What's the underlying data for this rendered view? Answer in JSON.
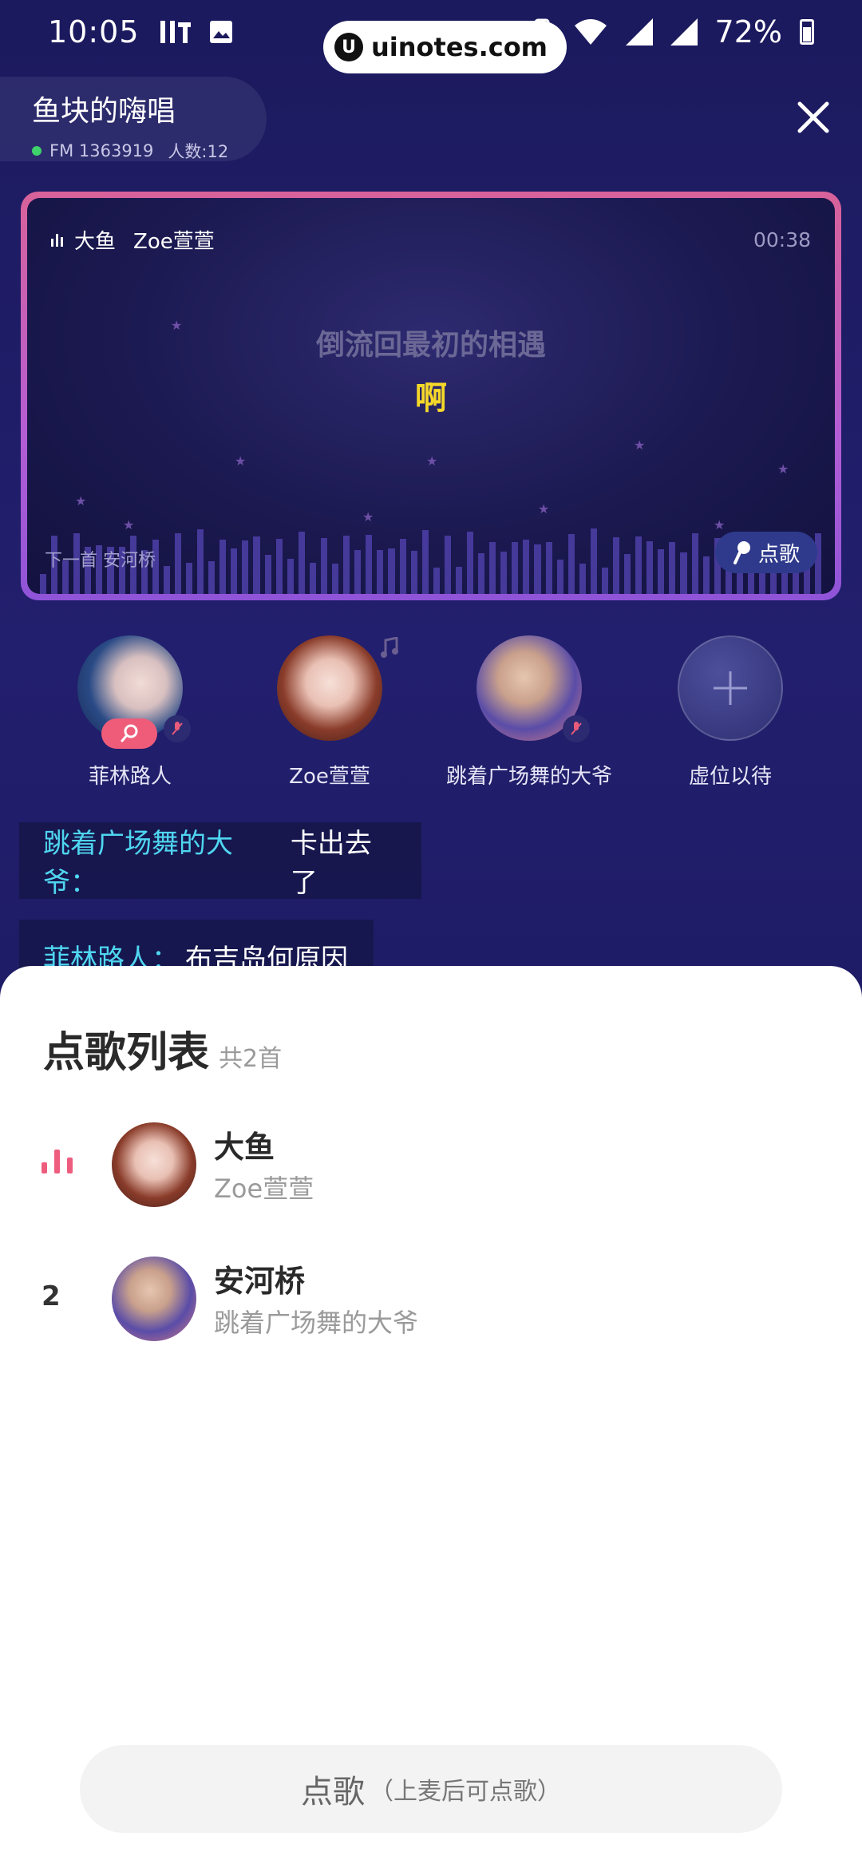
{
  "status_bar": {
    "time": "10:05",
    "battery": "72%",
    "watermark": "uinotes.com",
    "watermark_logo": "U"
  },
  "room": {
    "title": "鱼块的嗨唱",
    "fm": "FM 1363919",
    "count": "人数:12"
  },
  "stage": {
    "song": "大鱼",
    "singer": "Zoe萱萱",
    "time": "00:38",
    "lyric_prev": "倒流回最初的相遇",
    "lyric_current": "啊",
    "next_up": "下一首 安河桥",
    "order_label": "点歌"
  },
  "seats": [
    {
      "name": "菲林路人"
    },
    {
      "name": "Zoe萱萱"
    },
    {
      "name": "跳着广场舞的大爷"
    },
    {
      "name": "虚位以待"
    }
  ],
  "chat": [
    {
      "user": "跳着广场舞的大爷：",
      "text": "卡出去了"
    },
    {
      "user": "菲林路人：",
      "text": "布吉岛何原因"
    }
  ],
  "sheet": {
    "title": "点歌列表",
    "count": "共2首",
    "songs": [
      {
        "index": "",
        "title": "大鱼",
        "artist": "Zoe萱萱"
      },
      {
        "index": "2",
        "title": "安河桥",
        "artist": "跳着广场舞的大爷"
      }
    ],
    "button_label": "点歌",
    "button_sub": "（上麦后可点歌）"
  },
  "colors": {
    "accent_pink": "#ef5c7a",
    "lyric_yellow": "#f5d829",
    "chat_name_cyan": "#4fd6f0"
  }
}
